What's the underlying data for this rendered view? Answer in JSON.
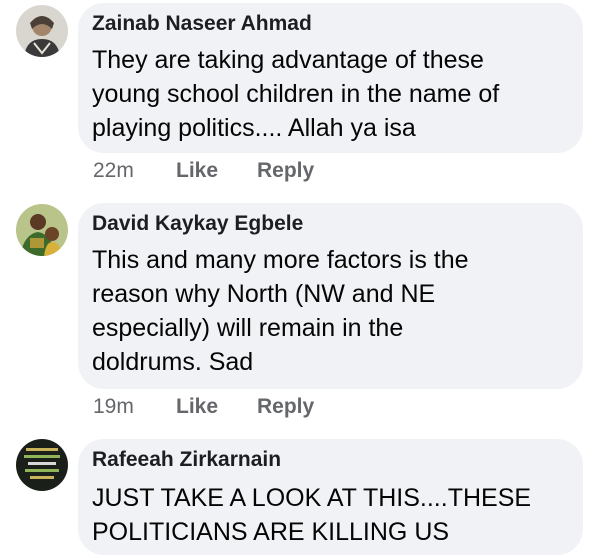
{
  "comments": [
    {
      "author": "Zainab Naseer Ahmad",
      "text": "They are taking advantage of these\nyoung school children in the name of\nplaying politics.... Allah ya isa",
      "time": "22m",
      "like_label": "Like",
      "reply_label": "Reply",
      "avatar_icon": "profile-photo-icon"
    },
    {
      "author": "David Kaykay Egbele",
      "text": "This and many more factors is the\nreason why North (NW and NE\nespecially) will remain in the\ndoldrums. Sad",
      "time": "19m",
      "like_label": "Like",
      "reply_label": "Reply",
      "avatar_icon": "profile-photo-icon"
    },
    {
      "author": "Rafeeah Zirkarnain",
      "text": "JUST TAKE A LOOK AT THIS....THESE\nPOLITICIANS ARE KILLING US",
      "avatar_icon": "profile-photo-icon"
    }
  ],
  "colors": {
    "bubble": "#f0f2f5",
    "author": "#1c1e21",
    "text": "#050505",
    "meta": "#65676b"
  }
}
